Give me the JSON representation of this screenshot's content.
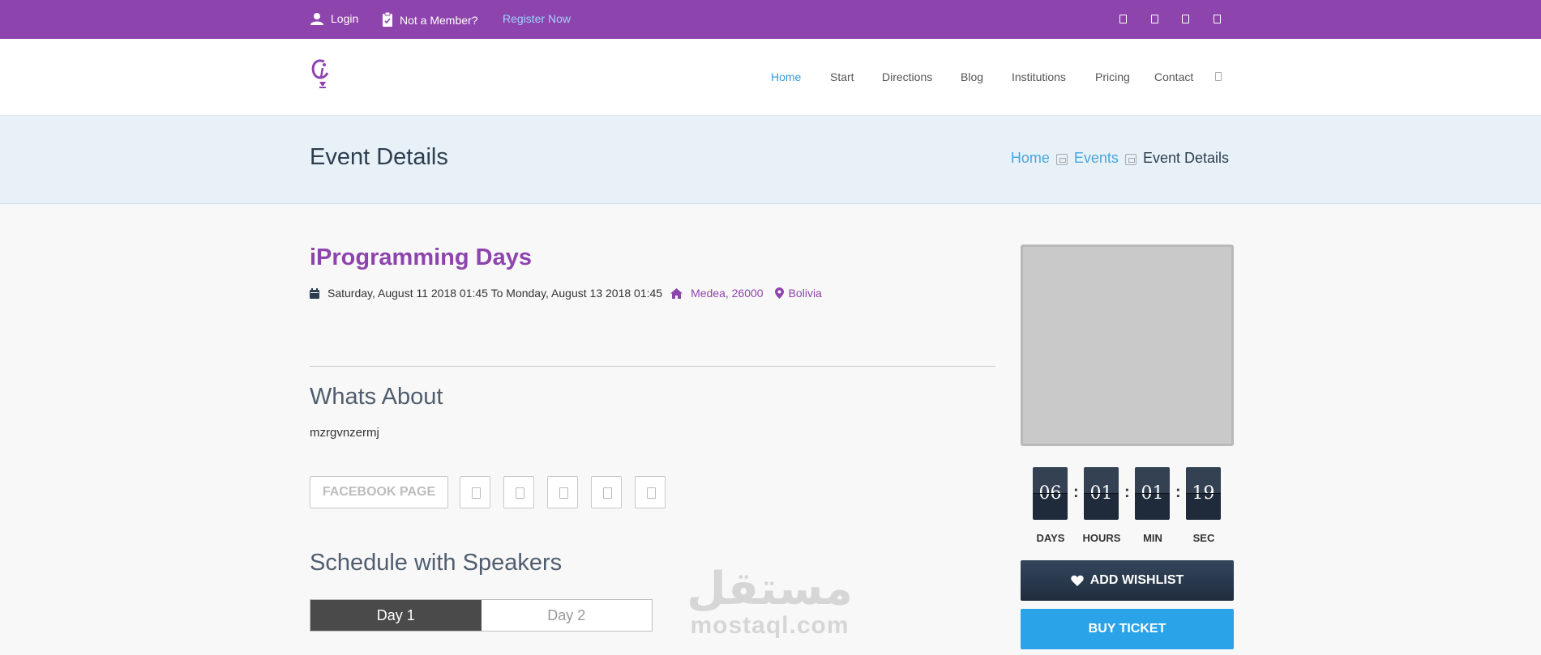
{
  "topbar": {
    "login": "Login",
    "not_member": "Not a Member?",
    "register": "Register Now",
    "social_icons": [
      "square-icon",
      "square-icon",
      "square-icon",
      "square-icon"
    ]
  },
  "nav": {
    "items": [
      "Home",
      "Start",
      "Directions",
      "Blog",
      "Institutions",
      "Pricing",
      "Contact"
    ],
    "active": "Home"
  },
  "page": {
    "title": "Event Details",
    "breadcrumb": [
      "Home",
      "Events",
      "Event Details"
    ]
  },
  "event": {
    "title": "iProgramming Days",
    "date_range": "Saturday, August 11 2018 01:45 To Monday, August 13 2018 01:45",
    "address": "Medea, 26000",
    "country": "Bolivia",
    "about_heading": "Whats About",
    "description": "mzrgvnzermj",
    "facebook_button": "FACEBOOK PAGE",
    "schedule_heading": "Schedule with Speakers",
    "tabs": [
      "Day 1",
      "Day 2"
    ]
  },
  "countdown": {
    "days": "06",
    "hours": "01",
    "min": "01",
    "sec": "19",
    "labels": [
      "DAYS",
      "HOURS",
      "MIN",
      "SEC"
    ]
  },
  "actions": {
    "wishlist": "ADD WISHLIST",
    "buy": "BUY TICKET"
  },
  "watermark": {
    "arabic": "مستقل",
    "latin": "mostaql.com"
  },
  "colors": {
    "brand": "#8e44ad",
    "link": "#3a9ad9",
    "buy": "#2aa3e8",
    "dark": "#2d3e50"
  }
}
